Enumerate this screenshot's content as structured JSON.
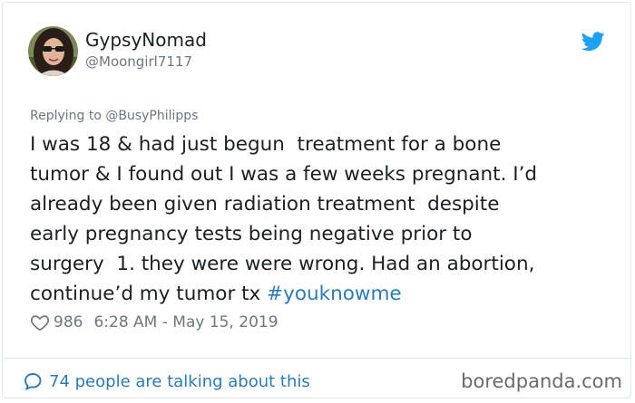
{
  "tweet": {
    "author": {
      "display_name": "GypsyNomad",
      "handle": "@Moongirl7117"
    },
    "replying_to": "Replying to @BusyPhilipps",
    "text_lines": [
      "I was 18 & had just begun  treatment for a bone",
      "tumor & I found out I was a few weeks pregnant. I’d",
      "already been given radiation treatment  despite",
      "early pregnancy tests being negative prior to",
      "surgery  1. they were were wrong. Had an abortion,",
      "continue’d my tumor tx "
    ],
    "hashtag": "#youknowme",
    "likes": "986",
    "timestamp": "6:28 AM - May 15, 2019",
    "conversation": "74 people are talking about this"
  },
  "watermark": "boredpanda.com",
  "icons": {
    "logo": "twitter-bird-icon",
    "like": "heart-icon",
    "reply": "speech-bubble-icon"
  },
  "colors": {
    "twitter_blue": "#1da1f2",
    "link_blue": "#2b7bb9",
    "secondary_text": "#697882",
    "primary_text": "#1c2022",
    "border": "#e1e8ed"
  }
}
